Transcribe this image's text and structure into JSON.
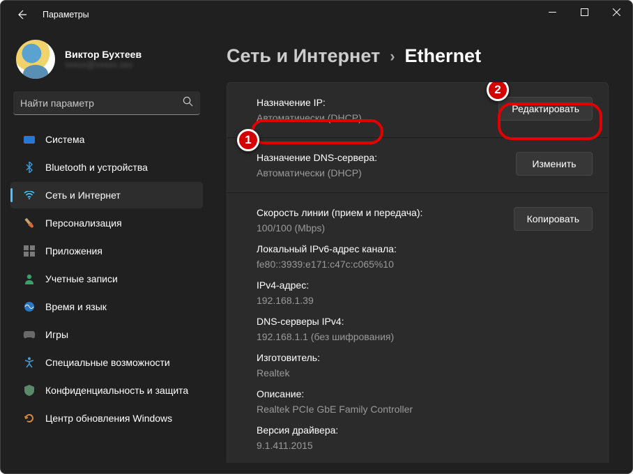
{
  "window": {
    "title": "Параметры"
  },
  "profile": {
    "name": "Виктор Бухтеев",
    "email": "xxxxx@xxxxx.xxx"
  },
  "search": {
    "placeholder": "Найти параметр"
  },
  "sidebar": {
    "items": [
      {
        "label": "Система",
        "icon": "system"
      },
      {
        "label": "Bluetooth и устройства",
        "icon": "bluetooth"
      },
      {
        "label": "Сеть и Интернет",
        "icon": "wifi",
        "active": true
      },
      {
        "label": "Персонализация",
        "icon": "brush"
      },
      {
        "label": "Приложения",
        "icon": "apps"
      },
      {
        "label": "Учетные записи",
        "icon": "person"
      },
      {
        "label": "Время и язык",
        "icon": "time"
      },
      {
        "label": "Игры",
        "icon": "games"
      },
      {
        "label": "Специальные возможности",
        "icon": "accessibility"
      },
      {
        "label": "Конфиденциальность и защита",
        "icon": "shield"
      },
      {
        "label": "Центр обновления Windows",
        "icon": "update"
      }
    ]
  },
  "breadcrumb": {
    "parent": "Сеть и Интернет",
    "current": "Ethernet"
  },
  "sections": {
    "ip": {
      "label": "Назначение IP:",
      "value": "Автоматически (DHCP)",
      "button": "Редактировать"
    },
    "dns": {
      "label": "Назначение DNS-сервера:",
      "value": "Автоматически (DHCP)",
      "button": "Изменить"
    },
    "details": {
      "button": "Копировать",
      "rows": [
        {
          "label": "Скорость линии (прием и передача):",
          "value": "100/100 (Mbps)"
        },
        {
          "label": "Локальный IPv6-адрес канала:",
          "value": "fe80::3939:e171:c47c:c065%10"
        },
        {
          "label": "IPv4-адрес:",
          "value": "192.168.1.39"
        },
        {
          "label": "DNS-серверы IPv4:",
          "value": "192.168.1.1 (без шифрования)"
        },
        {
          "label": "Изготовитель:",
          "value": "Realtek"
        },
        {
          "label": "Описание:",
          "value": "Realtek PCIe GbE Family Controller"
        },
        {
          "label": "Версия драйвера:",
          "value": "9.1.411.2015"
        }
      ]
    }
  },
  "callouts": {
    "c1": "1",
    "c2": "2"
  }
}
